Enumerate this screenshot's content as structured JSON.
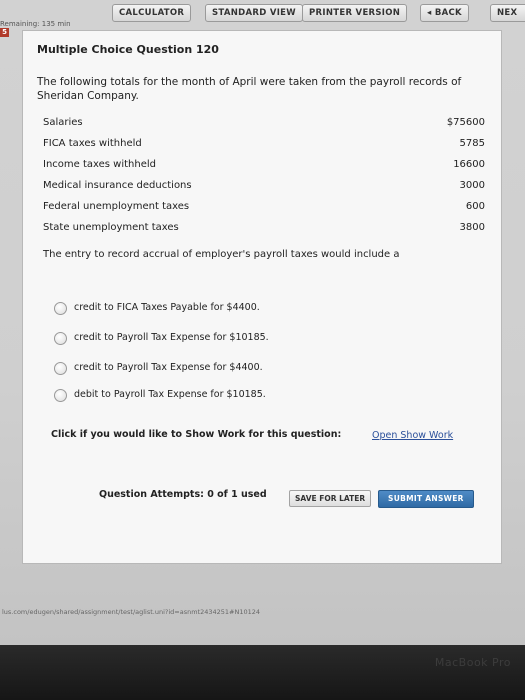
{
  "toolbar": {
    "calculator": "CALCULATOR",
    "standard_view": "STANDARD VIEW",
    "printer_version": "PRINTER VERSION",
    "back": "BACK",
    "next": "NEX"
  },
  "timer": "Remaining: 135 min",
  "question_number_badge": "5",
  "question": {
    "title": "Multiple Choice Question 120",
    "intro": "The following totals for the month of April were taken from the payroll records of Sheridan Company.",
    "items": [
      {
        "label": "Salaries",
        "value": "$75600"
      },
      {
        "label": "FICA taxes withheld",
        "value": "5785"
      },
      {
        "label": "Income taxes withheld",
        "value": "16600"
      },
      {
        "label": "Medical insurance deductions",
        "value": "3000"
      },
      {
        "label": "Federal unemployment taxes",
        "value": "600"
      },
      {
        "label": "State unemployment taxes",
        "value": "3800"
      }
    ],
    "prompt": "The entry to record accrual of employer's payroll taxes would include a",
    "options": [
      "credit to FICA Taxes Payable for $4400.",
      "credit to Payroll Tax Expense for $10185.",
      "credit to Payroll Tax Expense for $4400.",
      "debit to Payroll Tax Expense for $10185."
    ]
  },
  "show_work": {
    "text": "Click if you would like to Show Work for this question:",
    "link": "Open Show Work"
  },
  "attempts": "Question Attempts: 0 of 1 used",
  "save_label": "SAVE FOR LATER",
  "submit_label": "SUBMIT ANSWER",
  "status_url": "lus.com/edugen/shared/assignment/test/aglist.uni?id=asnmt2434251#N10124",
  "bezel_brand": "MacBook Pro",
  "colors": {
    "submit_blue": "#3a78b8",
    "link_blue": "#2a4f9a",
    "badge_red": "#b13a2a"
  }
}
